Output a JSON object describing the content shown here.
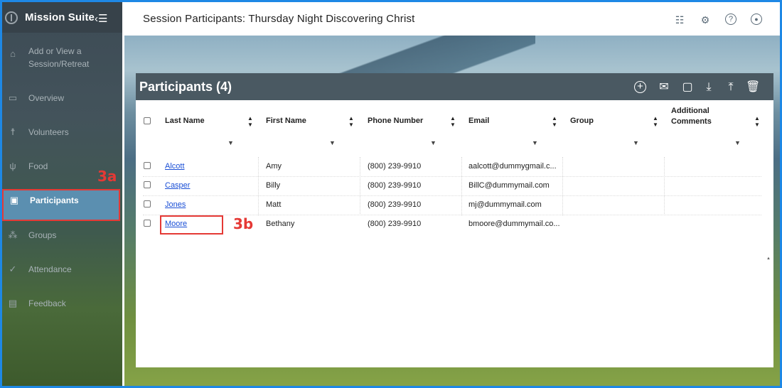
{
  "app": {
    "name": "Mission Suite",
    "collapse_icon": "collapse-menu-icon"
  },
  "sidebar": {
    "items": [
      {
        "label": "Add or View a Session/Retreat",
        "icon": "home-icon"
      },
      {
        "label": "Overview",
        "icon": "calendar-icon"
      },
      {
        "label": "Volunteers",
        "icon": "person-icon"
      },
      {
        "label": "Food",
        "icon": "utensils-icon"
      },
      {
        "label": "Participants",
        "icon": "contact-card-icon",
        "active": true
      },
      {
        "label": "Groups",
        "icon": "groups-icon"
      },
      {
        "label": "Attendance",
        "icon": "attendance-icon"
      },
      {
        "label": "Feedback",
        "icon": "feedback-icon"
      }
    ]
  },
  "annotations": {
    "a": "3a",
    "b": "3b"
  },
  "header": {
    "title": "Session Participants: Thursday Night Discovering Christ",
    "icons": [
      "chat-icon",
      "settings-icon",
      "help-icon",
      "account-icon"
    ]
  },
  "panel": {
    "title": "Participants (4)",
    "actions": [
      "add-icon",
      "email-icon",
      "message-icon",
      "download-icon",
      "upload-icon",
      "delete-icon"
    ]
  },
  "table": {
    "columns": [
      "Last Name",
      "First Name",
      "Phone Number",
      "Email",
      "Group",
      "Additional Comments"
    ],
    "rows": [
      {
        "last": "Alcott",
        "first": "Amy",
        "phone": "(800) 239-9910",
        "email": "aalcott@dummygmail.c...",
        "group": "",
        "comments": ""
      },
      {
        "last": "Casper",
        "first": "Billy",
        "phone": "(800) 239-9910",
        "email": "BillC@dummymail.com",
        "group": "",
        "comments": ""
      },
      {
        "last": "Jones",
        "first": "Matt",
        "phone": "(800) 239-9910",
        "email": "mj@dummymail.com",
        "group": "",
        "comments": ""
      },
      {
        "last": "Moore",
        "first": "Bethany",
        "phone": "(800) 239-9910",
        "email": "bmoore@dummymail.co...",
        "group": "",
        "comments": ""
      }
    ]
  },
  "colors": {
    "accent_border": "#1e88e5",
    "annotation_red": "#e53935",
    "active_nav": "#5b8fb0",
    "panel_header": "#4a5962"
  }
}
